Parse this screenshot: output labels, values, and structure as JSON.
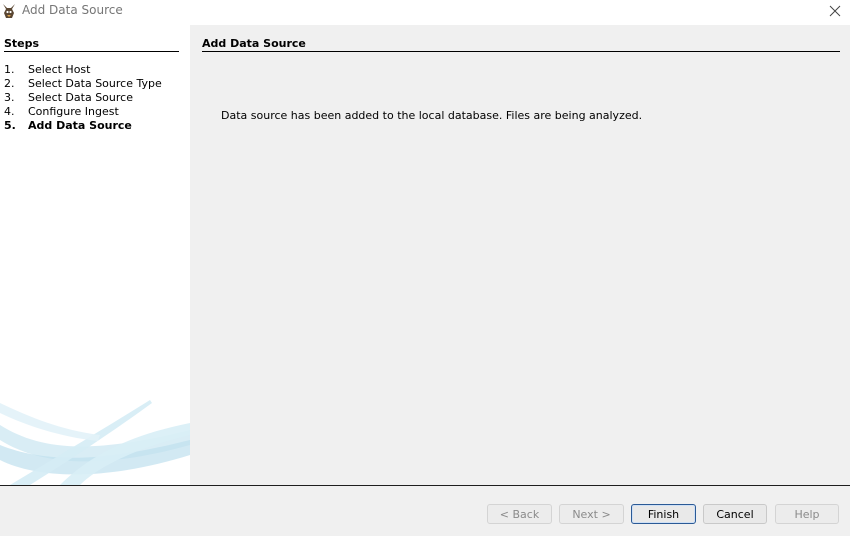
{
  "window": {
    "title": "Add Data Source",
    "app_icon": "autopsy-dog-icon",
    "close_icon": "close-icon"
  },
  "steps": {
    "heading": "Steps",
    "items": [
      {
        "num": "1.",
        "label": "Select Host"
      },
      {
        "num": "2.",
        "label": "Select Data Source Type"
      },
      {
        "num": "3.",
        "label": "Select Data Source"
      },
      {
        "num": "4.",
        "label": "Configure Ingest"
      },
      {
        "num": "5.",
        "label": "Add Data Source",
        "current": true
      }
    ]
  },
  "content": {
    "heading": "Add Data Source",
    "message": "Data source has been added to the local database. Files are being analyzed."
  },
  "buttons": {
    "back": "< Back",
    "next": "Next >",
    "finish": "Finish",
    "cancel": "Cancel",
    "help": "Help"
  },
  "colors": {
    "dialog_background": "#f0f0f0",
    "steps_background": "#ffffff",
    "swoosh": "#bfe0ee",
    "disabled_text": "#8a8a8a",
    "default_button_border": "#2b5a96"
  }
}
